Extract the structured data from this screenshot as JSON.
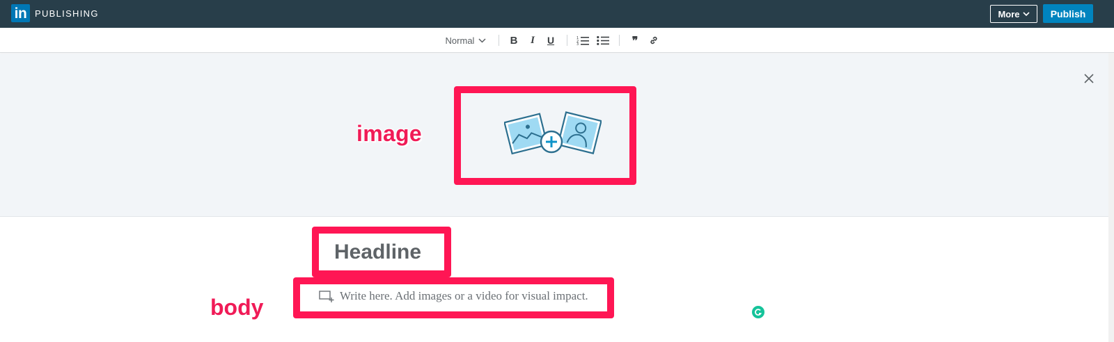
{
  "topbar": {
    "logo_text": "in",
    "brand": "PUBLISHING",
    "more_label": "More",
    "publish_label": "Publish"
  },
  "toolbar": {
    "style_value": "Normal",
    "bold": "B",
    "italic": "I",
    "underline": "U",
    "blockquote": "❞"
  },
  "annotations": {
    "image": "image",
    "body": "body"
  },
  "editor": {
    "headline_placeholder": "Headline",
    "body_placeholder": "Write here. Add images or a video for visual impact."
  },
  "icons": [
    "linkedin-logo-icon",
    "chevron-down-icon",
    "numbered-list-icon",
    "bulleted-list-icon",
    "quote-icon",
    "link-icon",
    "close-icon",
    "image-upload-icon",
    "add-media-icon",
    "grammarly-icon"
  ],
  "colors": {
    "topbar": "#283e4a",
    "publish_button": "#0084bf",
    "annotation": "#ff1654",
    "hero_bg": "#f2f5f8",
    "grammarly": "#15c39a"
  }
}
